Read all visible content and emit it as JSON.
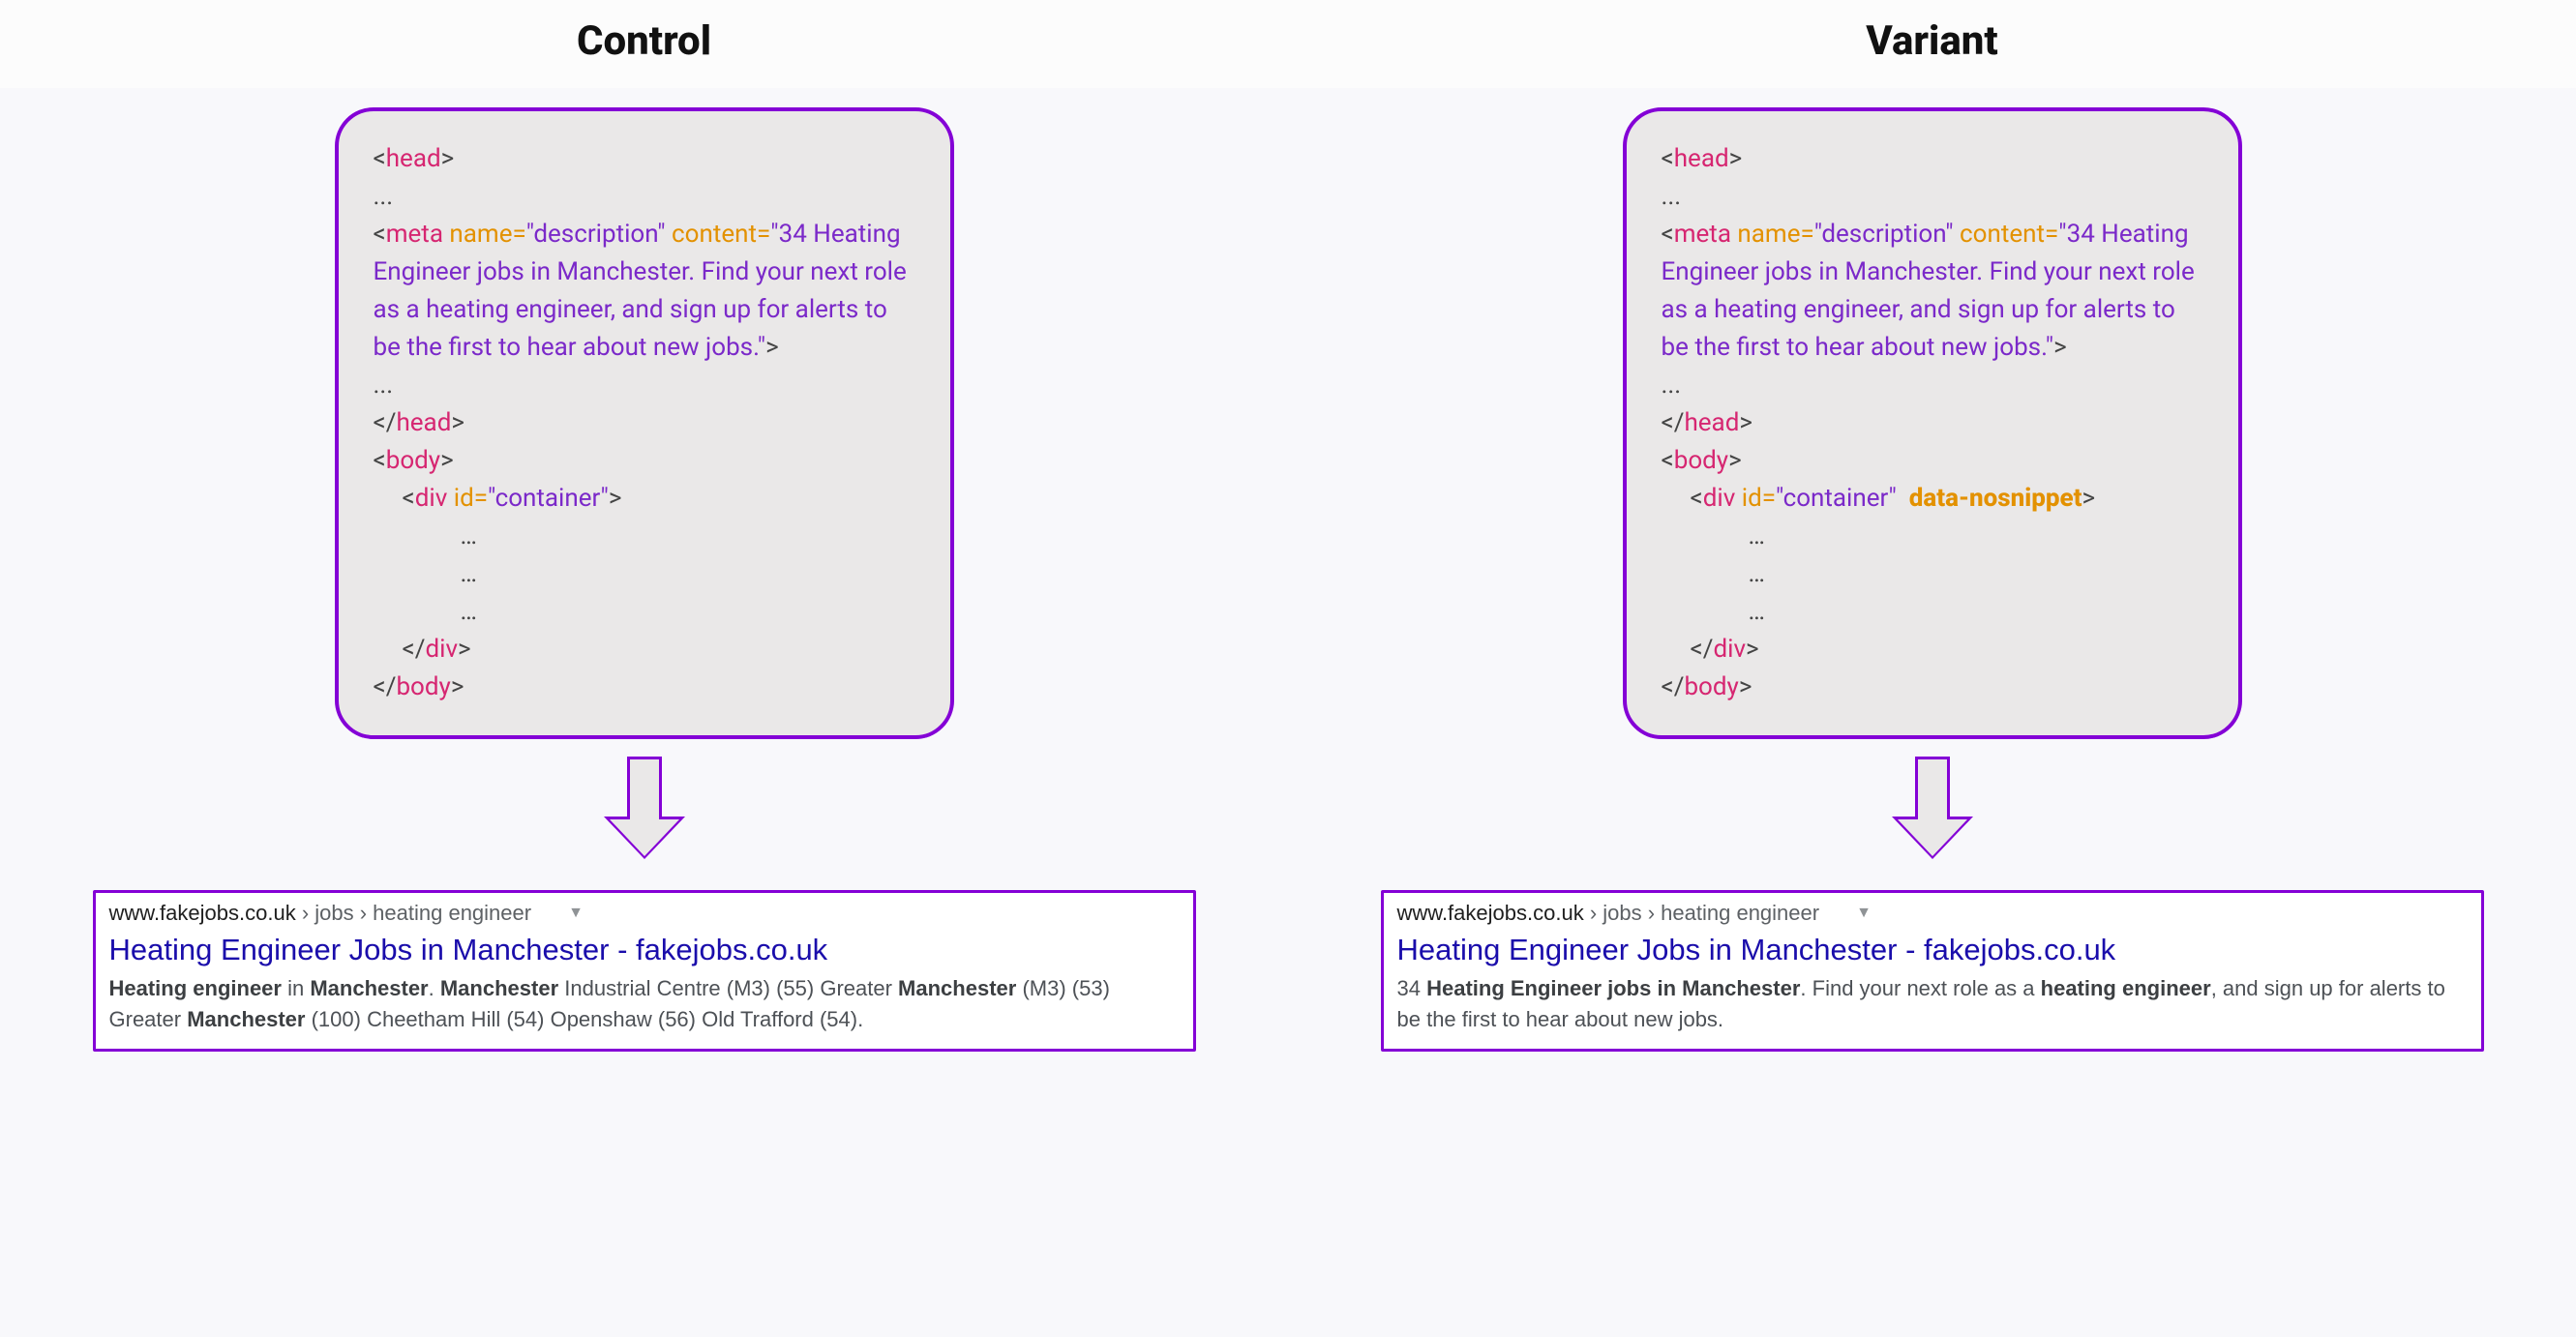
{
  "headings": {
    "control": "Control",
    "variant": "Variant"
  },
  "code": {
    "head_open": "head",
    "head_close": "head",
    "meta_tag": "meta",
    "meta_attr_name": "name=",
    "meta_attr_name_val": "\"description\"",
    "meta_attr_content": "content=",
    "meta_attr_content_val": "\"34 Heating Engineer jobs in Manchester. Find your next role as a heating engineer, and sign up for alerts to be the first to hear about new jobs.\"",
    "body_open": "body",
    "body_close": "body",
    "div_tag": "div",
    "div_attr_id": "id=",
    "div_attr_id_val": "\"container\"",
    "div_attr_nosnippet": "data-nosnippet",
    "ellipsis": "...",
    "dots": "…"
  },
  "serp": {
    "breadcrumb_domain": "www.fakejobs.co.uk",
    "breadcrumb_path": " › jobs › heating engineer",
    "title": "Heating Engineer Jobs in Manchester - fakejobs.co.uk",
    "control_desc": {
      "p1a": "Heating engineer",
      "p1b": " in ",
      "p1c": "Manchester",
      "p1d": ". ",
      "p1e": "Manchester",
      "p1f": " Industrial Centre (M3) (55) Greater ",
      "p1g": "Manchester",
      "p1h": " (M3) (53) Greater ",
      "p1i": "Manchester",
      "p1j": " (100) Cheetham Hill (54) Openshaw (56) Old Trafford (54)."
    },
    "variant_desc": {
      "p2a": "34 ",
      "p2b": "Heating Engineer jobs in Manchester",
      "p2c": ". Find your next role as a ",
      "p2d": "heating engineer",
      "p2e": ", and sign up for alerts to be the first to hear about new jobs."
    }
  }
}
